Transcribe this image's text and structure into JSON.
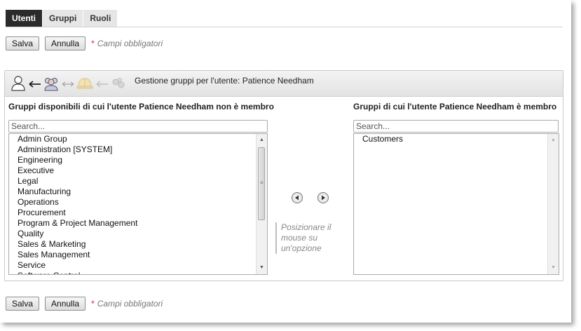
{
  "tabs": [
    {
      "label": "Utenti",
      "active": true
    },
    {
      "label": "Gruppi",
      "active": false
    },
    {
      "label": "Ruoli",
      "active": false
    }
  ],
  "actions_top": {
    "save": "Salva",
    "cancel": "Annulla",
    "required_star": "*",
    "required_note": "Campi obbligatori"
  },
  "actions_bottom": {
    "save": "Salva",
    "cancel": "Annulla",
    "required_star": "*",
    "required_note": "Campi obbligatori"
  },
  "panel": {
    "title": "Gestione gruppi per l'utente: Patience Needham",
    "icons": [
      "user-icon",
      "arrow-left-icon",
      "group-icon",
      "double-arrow-icon",
      "role-helmet-icon",
      "arrow-left-icon",
      "permissions-icon"
    ]
  },
  "available": {
    "header": "Gruppi disponibili di cui l'utente Patience Needham non è membro",
    "search_placeholder": "Search...",
    "items": [
      "Admin Group",
      "Administration [SYSTEM]",
      "Engineering",
      "Executive",
      "Legal",
      "Manufacturing",
      "Operations",
      "Procurement",
      "Program & Project Management",
      "Quality",
      "Sales & Marketing",
      "Sales Management",
      "Service",
      "Software Control"
    ]
  },
  "member": {
    "header": "Gruppi di cui l'utente Patience Needham è membro",
    "search_placeholder": "Search...",
    "items": [
      "Customers"
    ]
  },
  "hint": "Posizionare il mouse su un'opzione",
  "colors": {
    "tab_active": "#2b2b2b",
    "required_star": "#d23"
  }
}
